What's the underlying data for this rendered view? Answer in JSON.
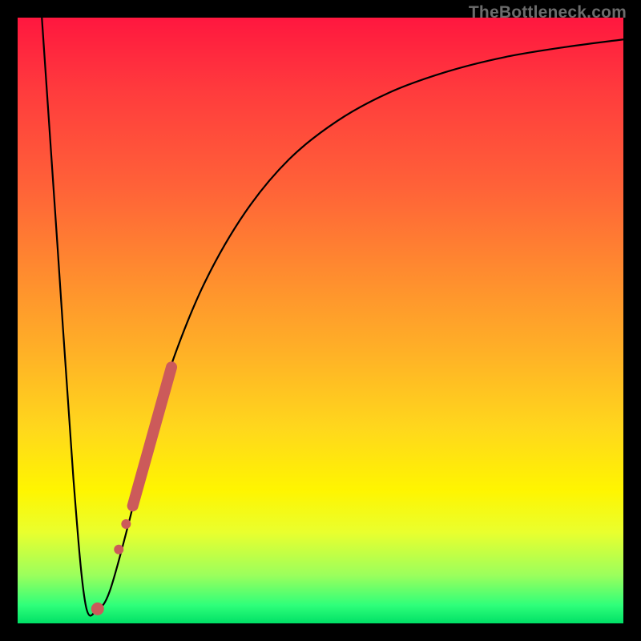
{
  "watermark": "TheBottleneck.com",
  "chart_data": {
    "type": "line",
    "title": "",
    "xlabel": "",
    "ylabel": "",
    "xlim": [
      0,
      100
    ],
    "ylim": [
      0,
      100
    ],
    "notes": "Axes have no visible tick labels; values are relative 0–100 read from pixel positions within the 756×756 plot area. Background is a vertical gradient from red (top) to green (bottom). Curve is black. Salmon-colored dots lie along the curve.",
    "series": [
      {
        "name": "bottleneck-curve",
        "color": "#000000",
        "x": [
          4.0,
          6.6,
          9.2,
          11.2,
          13.2,
          15.2,
          18.5,
          21.8,
          25.8,
          31.0,
          37.6,
          44.8,
          52.7,
          61.3,
          70.6,
          80.5,
          90.8,
          100.0
        ],
        "y": [
          100.0,
          62.0,
          24.0,
          3.2,
          2.4,
          5.3,
          17.2,
          31.0,
          43.9,
          56.5,
          67.9,
          76.6,
          82.9,
          87.6,
          91.0,
          93.5,
          95.2,
          96.4
        ]
      },
      {
        "name": "highlight-dots",
        "color": "#cc5a5a",
        "type": "scatter",
        "points": [
          {
            "x": 13.2,
            "y": 2.4,
            "r": 8
          },
          {
            "x": 16.7,
            "y": 12.2,
            "r": 6
          },
          {
            "x": 17.9,
            "y": 16.4,
            "r": 6
          },
          {
            "x_start": 19.0,
            "y_start": 19.4,
            "x_end": 25.4,
            "y_end": 42.3,
            "segment": true,
            "width": 14
          }
        ]
      }
    ]
  }
}
